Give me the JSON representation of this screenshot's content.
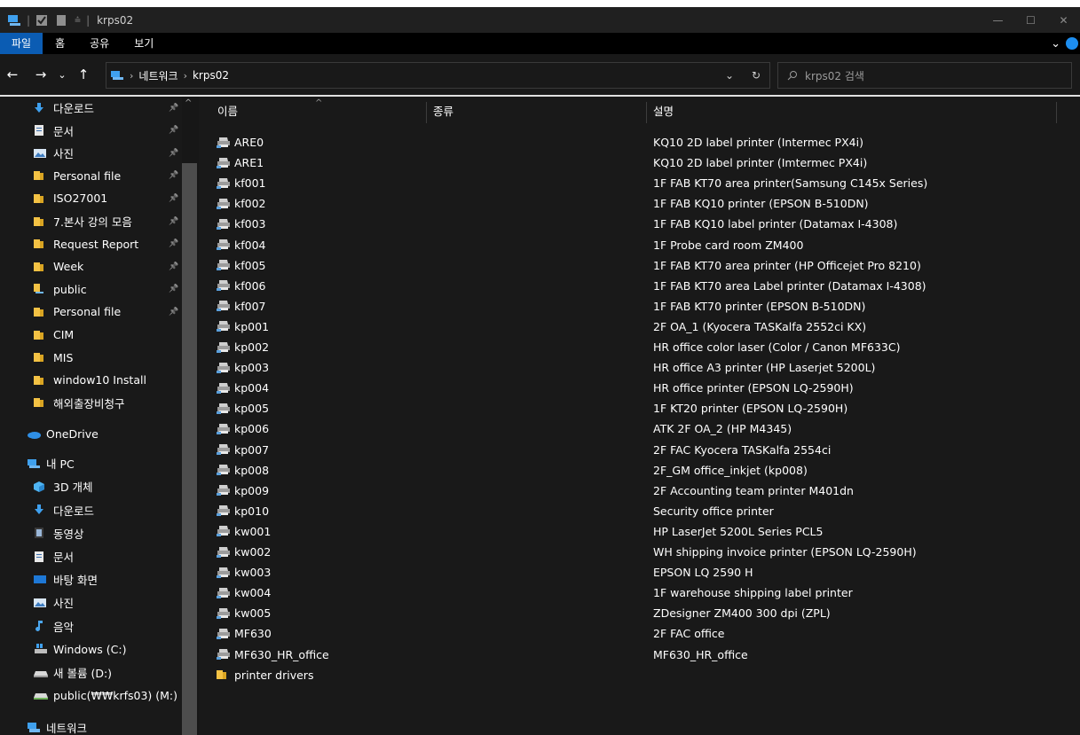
{
  "window": {
    "title": "krps02",
    "controls": {
      "minimize": "—",
      "maximize": "☐",
      "close": "✕"
    }
  },
  "ribbon": {
    "tabs": [
      "파일",
      "홈",
      "공유",
      "보기"
    ],
    "active_tab": "파일",
    "expand": "⌄"
  },
  "nav": {
    "back": "←",
    "forward": "→",
    "recent": "⌄",
    "up": "↑",
    "breadcrumb": [
      "네트워크",
      "krps02"
    ],
    "dropdown": "⌄",
    "refresh": "↻",
    "search_placeholder": "krps02 검색"
  },
  "sidebar": {
    "quick_access": [
      {
        "label": "다운로드",
        "icon": "download-arrow-icon",
        "pinned": true
      },
      {
        "label": "문서",
        "icon": "document-icon",
        "pinned": true
      },
      {
        "label": "사진",
        "icon": "pictures-icon",
        "pinned": true
      },
      {
        "label": "Personal file",
        "icon": "folder-icon",
        "pinned": true
      },
      {
        "label": "ISO27001",
        "icon": "folder-icon",
        "pinned": true
      },
      {
        "label": "7.본사 강의 모음",
        "icon": "folder-icon",
        "pinned": true
      },
      {
        "label": "Request Report",
        "icon": "folder-icon",
        "pinned": true
      },
      {
        "label": "Week",
        "icon": "folder-icon",
        "pinned": true
      },
      {
        "label": "public",
        "icon": "network-folder-icon",
        "pinned": true
      },
      {
        "label": "Personal file",
        "icon": "folder-icon",
        "pinned": true
      },
      {
        "label": "CIM",
        "icon": "folder-icon",
        "pinned": false
      },
      {
        "label": "MIS",
        "icon": "folder-icon",
        "pinned": false
      },
      {
        "label": "window10 Install",
        "icon": "folder-icon",
        "pinned": false
      },
      {
        "label": "해외출장비청구",
        "icon": "folder-icon",
        "pinned": false
      }
    ],
    "onedrive": "OneDrive",
    "this_pc": "내 PC",
    "pc_items": [
      {
        "label": "3D 개체",
        "icon": "3d-objects-icon"
      },
      {
        "label": "다운로드",
        "icon": "download-arrow-icon"
      },
      {
        "label": "동영상",
        "icon": "video-icon"
      },
      {
        "label": "문서",
        "icon": "document-icon"
      },
      {
        "label": "바탕 화면",
        "icon": "desktop-icon"
      },
      {
        "label": "사진",
        "icon": "pictures-icon"
      },
      {
        "label": "음악",
        "icon": "music-icon"
      },
      {
        "label": "Windows (C:)",
        "icon": "windows-drive-icon"
      },
      {
        "label": "새 볼륨 (D:)",
        "icon": "drive-icon"
      },
      {
        "label": "public(₩₩krfs03) (M:)",
        "icon": "network-drive-icon"
      }
    ],
    "network": "네트워크"
  },
  "columns": {
    "name": "이름",
    "type": "종류",
    "description": "설명"
  },
  "items": [
    {
      "name": "ARE0",
      "description": "KQ10 2D label printer (Intermec PX4i)",
      "kind": "printer"
    },
    {
      "name": "ARE1",
      "description": "KQ10 2D label printer (Imtermec PX4i)",
      "kind": "printer"
    },
    {
      "name": "kf001",
      "description": "1F FAB KT70 area printer(Samsung C145x Series)",
      "kind": "printer"
    },
    {
      "name": "kf002",
      "description": "1F FAB KQ10 printer (EPSON B-510DN)",
      "kind": "printer"
    },
    {
      "name": "kf003",
      "description": "1F FAB KQ10 label printer (Datamax I-4308)",
      "kind": "printer"
    },
    {
      "name": "kf004",
      "description": "1F Probe card room ZM400",
      "kind": "printer"
    },
    {
      "name": "kf005",
      "description": "1F FAB KT70 area printer (HP Officejet Pro 8210)",
      "kind": "printer"
    },
    {
      "name": "kf006",
      "description": "1F FAB KT70 area Label printer (Datamax I-4308)",
      "kind": "printer"
    },
    {
      "name": "kf007",
      "description": "1F FAB KT70 printer (EPSON B-510DN)",
      "kind": "printer"
    },
    {
      "name": "kp001",
      "description": "2F OA_1 (Kyocera TASKalfa 2552ci KX)",
      "kind": "printer"
    },
    {
      "name": "kp002",
      "description": "HR office color laser (Color / Canon MF633C)",
      "kind": "printer"
    },
    {
      "name": "kp003",
      "description": "HR office A3 printer (HP Laserjet 5200L)",
      "kind": "printer"
    },
    {
      "name": "kp004",
      "description": "HR office printer (EPSON LQ-2590H)",
      "kind": "printer"
    },
    {
      "name": "kp005",
      "description": "1F KT20 printer (EPSON LQ-2590H)",
      "kind": "printer"
    },
    {
      "name": "kp006",
      "description": "ATK 2F OA_2 (HP M4345)",
      "kind": "printer"
    },
    {
      "name": "kp007",
      "description": "2F FAC Kyocera TASKalfa 2554ci",
      "kind": "printer"
    },
    {
      "name": "kp008",
      "description": "2F_GM office_inkjet (kp008)",
      "kind": "printer"
    },
    {
      "name": "kp009",
      "description": "2F Accounting team printer M401dn",
      "kind": "printer"
    },
    {
      "name": "kp010",
      "description": "Security office printer",
      "kind": "printer"
    },
    {
      "name": "kw001",
      "description": "HP LaserJet 5200L Series PCL5",
      "kind": "printer"
    },
    {
      "name": "kw002",
      "description": "WH shipping invoice printer (EPSON LQ-2590H)",
      "kind": "printer"
    },
    {
      "name": "kw003",
      "description": "EPSON LQ 2590 H",
      "kind": "printer"
    },
    {
      "name": "kw004",
      "description": "1F warehouse shipping label printer",
      "kind": "printer"
    },
    {
      "name": "kw005",
      "description": "ZDesigner ZM400 300 dpi (ZPL)",
      "kind": "printer"
    },
    {
      "name": "MF630",
      "description": "2F FAC office",
      "kind": "printer"
    },
    {
      "name": "MF630_HR_office",
      "description": "MF630_HR_office",
      "kind": "printer"
    },
    {
      "name": "printer drivers",
      "description": "",
      "kind": "folder"
    }
  ],
  "colors": {
    "accent": "#0b5cb3",
    "folder": "#f4c244",
    "background": "#191919",
    "titlebar": "#202020",
    "ribbon": "#000000"
  }
}
